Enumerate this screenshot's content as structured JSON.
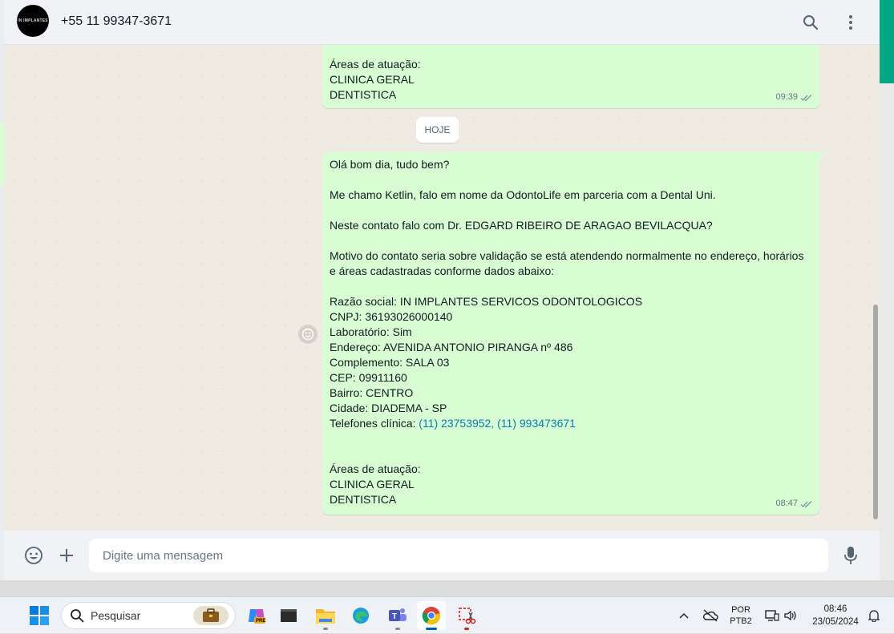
{
  "header": {
    "avatar_text": "IN IMPLANTES",
    "contact_name": "+55 11 99347-3671"
  },
  "messages": [
    {
      "lines": [
        "Áreas de atuação:",
        "CLINICA GERAL",
        "DENTISTICA"
      ],
      "time": "09:39"
    },
    {
      "date_chip": "HOJE"
    },
    {
      "lines": [
        "Olá bom dia, tudo bem?",
        "",
        "Me chamo Ketlin, falo em nome da OdontoLife em parceria com a Dental Uni.",
        "",
        "Neste contato falo com Dr. EDGARD RIBEIRO DE ARAGAO BEVILACQUA?",
        "",
        "Motivo do contato seria sobre validação se está atendendo normalmente no endereço, horários",
        "e áreas cadastradas conforme dados abaixo:",
        "",
        "Razão social: IN IMPLANTES SERVICOS ODONTOLOGICOS",
        "CNPJ: 36193026000140",
        "Laboratório: Sim",
        "Endereço: AVENIDA ANTONIO PIRANGA nº 486",
        "Complemento: SALA 03",
        "CEP: 09911160",
        "Bairro: CENTRO",
        "Cidade: DIADEMA - SP"
      ],
      "phones_label": "Telefones clínica: ",
      "phone_1": "(11) 23753952",
      "phone_sep": ", ",
      "phone_2": "(11) 993473671",
      "tail_lines": [
        "",
        "",
        "Áreas de atuação:",
        "CLINICA GERAL",
        "DENTISTICA"
      ],
      "time": "08:47"
    }
  ],
  "composer": {
    "placeholder": "Digite uma mensagem"
  },
  "taskbar": {
    "search_placeholder": "Pesquisar",
    "copilot_badge": "PRE",
    "lang_top": "POR",
    "lang_bottom": "PTB2",
    "time": "08:46",
    "date": "23/05/2024"
  },
  "colors": {
    "outgoing_bubble": "#d9fdd3",
    "chat_bg": "#efeae2",
    "accent": "#00a884",
    "link": "#027eb5"
  }
}
